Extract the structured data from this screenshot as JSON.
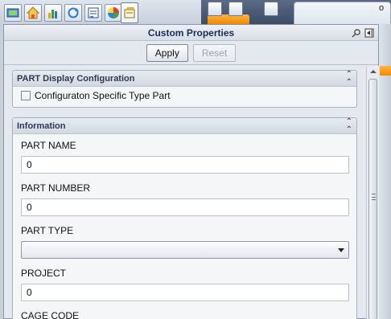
{
  "toolbar": {
    "icons": [
      "window-icon",
      "home-icon",
      "chart-icon",
      "refresh-icon",
      "properties-icon",
      "color-wheel-icon",
      "custom-properties-icon"
    ],
    "bg_tab_fragment": "o"
  },
  "panel": {
    "title": "Custom Properties",
    "apply_label": "Apply",
    "reset_label": "Reset"
  },
  "section_display": {
    "title": "PART Display Configuration",
    "checkbox_label": "Configuraton Specific Type Part",
    "checked": false
  },
  "section_info": {
    "title": "Information",
    "fields": [
      {
        "label": "PART  NAME",
        "value": "0"
      },
      {
        "label": "PART NUMBER",
        "value": "0"
      },
      {
        "label": "PART TYPE",
        "value": ""
      },
      {
        "label": "PROJECT",
        "value": "0"
      },
      {
        "label": "CAGE CODE",
        "value": ""
      }
    ]
  },
  "colors": {
    "title_text": "#1a2d56",
    "panel_bg": "#e4e8ef",
    "accent_orange": "#f08a00"
  }
}
